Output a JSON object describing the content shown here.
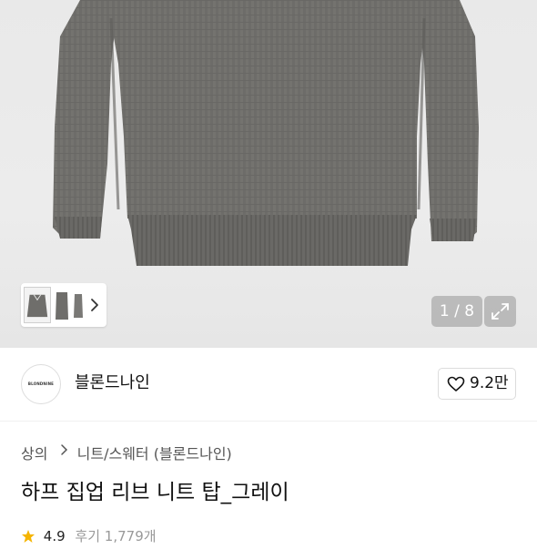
{
  "gallery": {
    "counter": "1 / 8",
    "thumbnails": [
      "sweater-front",
      "sweater-side",
      "sweater-back"
    ]
  },
  "brand": {
    "logo_text": "BLONDNINE",
    "name": "블론드나인",
    "likes": "9.2만"
  },
  "breadcrumb": {
    "level1": "상의",
    "level2": "니트/스웨터 (블론드나인)"
  },
  "product": {
    "title": "하프 집업 리브 니트 탑_그레이",
    "rating": "4.9",
    "reviews": "후기 1,779개"
  },
  "colors": {
    "accent_star": "#f5b400",
    "sweater": "#6f6e6b"
  },
  "icons": [
    "chevron-right-icon",
    "expand-icon",
    "heart-icon",
    "star-icon"
  ]
}
